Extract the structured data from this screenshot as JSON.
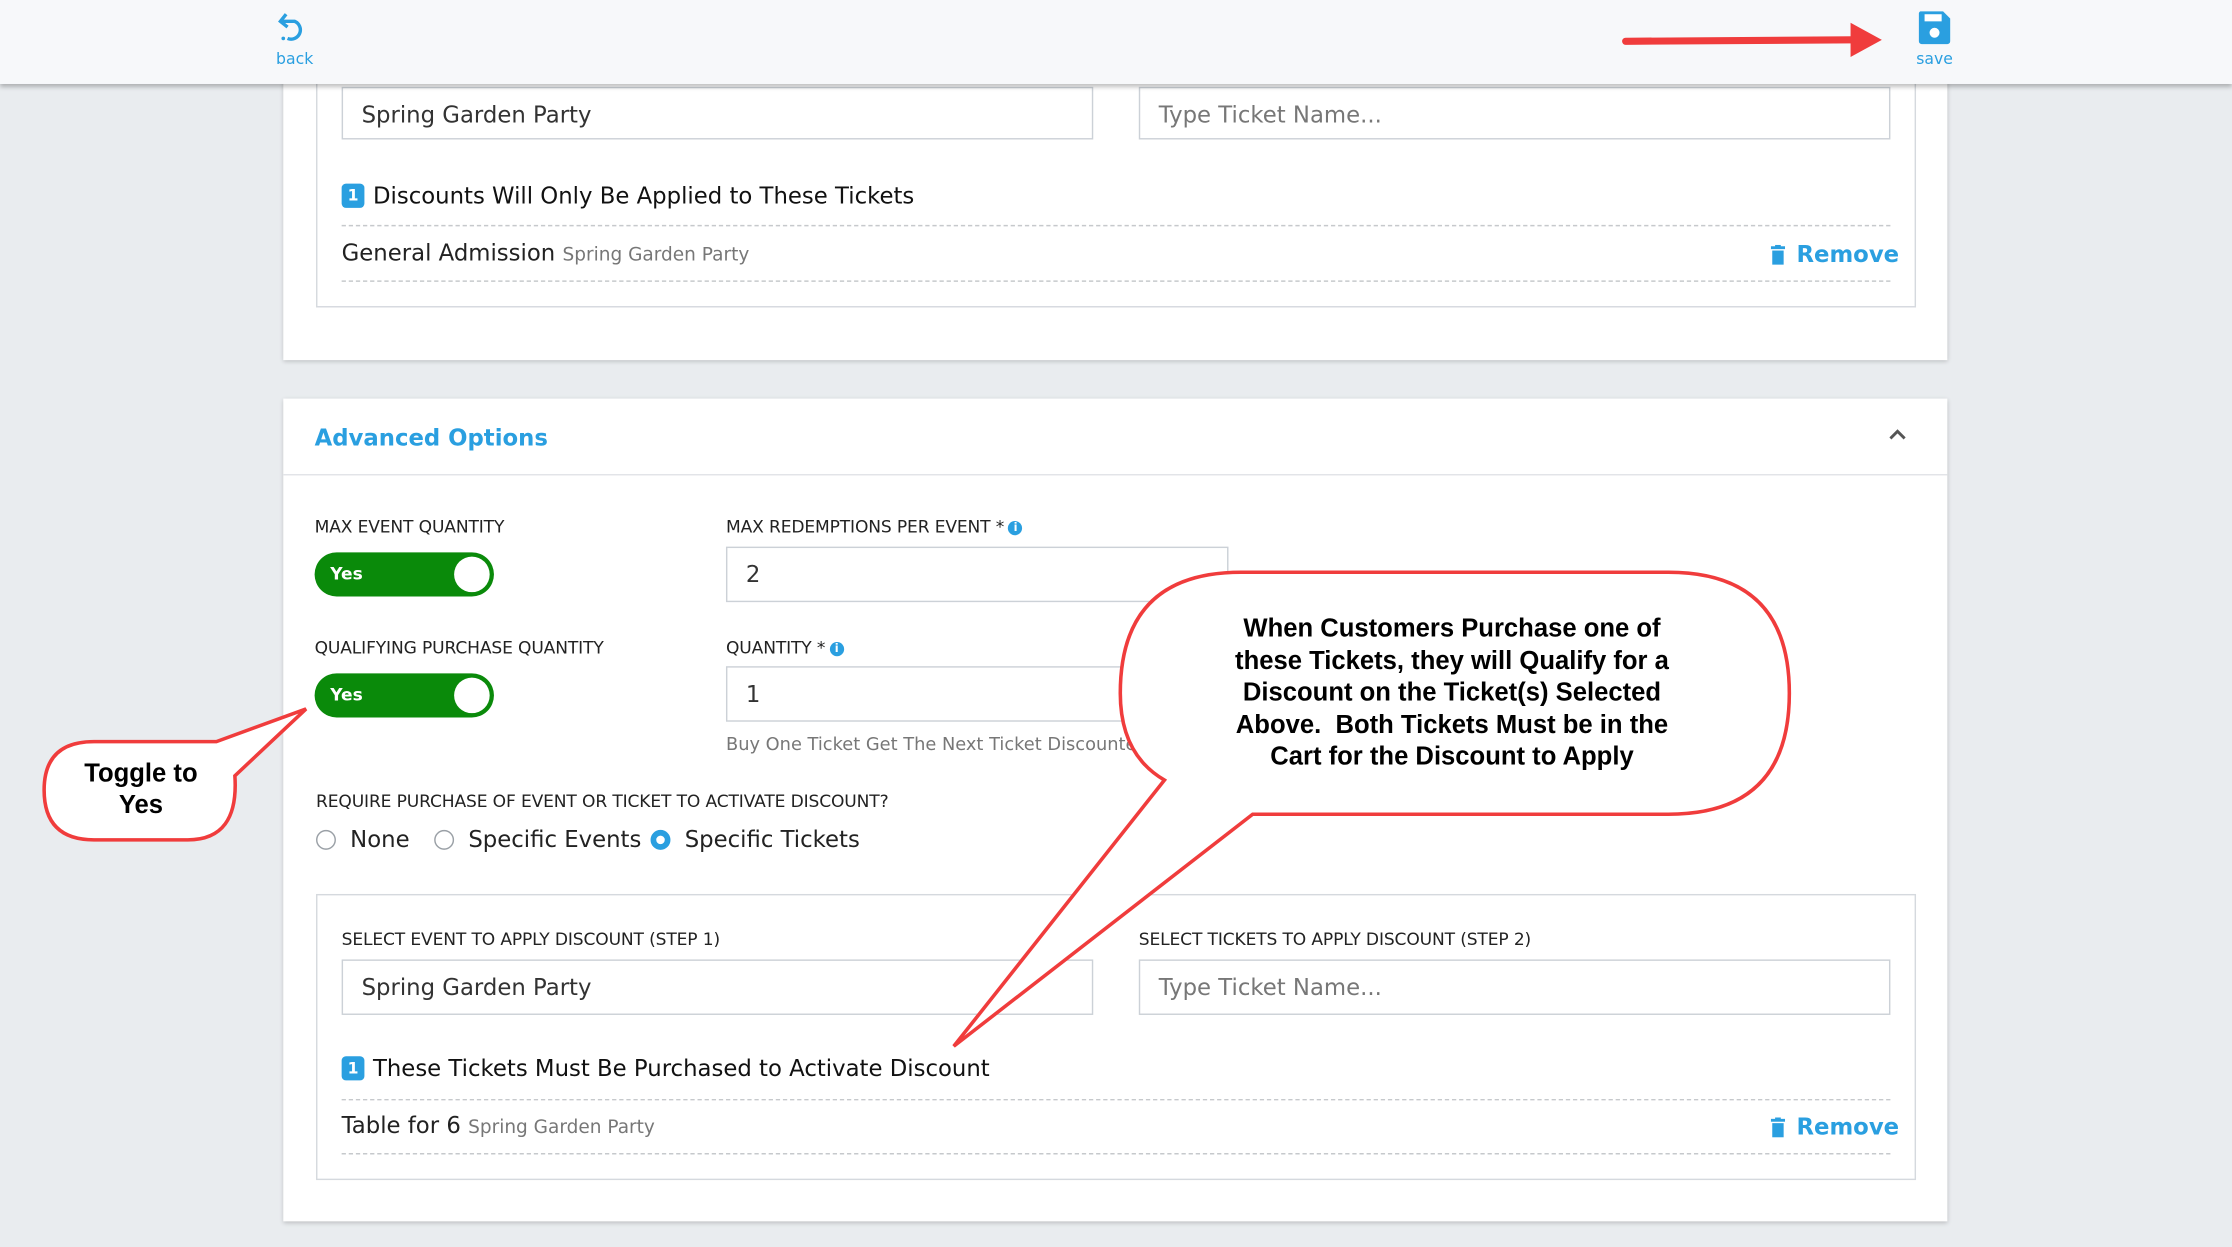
{
  "header": {
    "back_label": "back",
    "save_label": "save"
  },
  "ticket_section": {
    "event_value": "Spring Garden Party",
    "ticket_placeholder": "Type Ticket Name...",
    "count": "1",
    "heading": "Discounts Will Only Be Applied to These Tickets",
    "items": [
      {
        "name": "General Admission",
        "event": "Spring Garden Party",
        "remove_label": "Remove"
      }
    ]
  },
  "advanced": {
    "title": "Advanced Options",
    "max_event_quantity": {
      "label": "MAX EVENT QUANTITY",
      "toggle": "Yes"
    },
    "max_redemptions": {
      "label": "MAX REDEMPTIONS PER EVENT *",
      "value": "2"
    },
    "qualifying_quantity": {
      "label": "QUALIFYING PURCHASE QUANTITY",
      "toggle": "Yes"
    },
    "quantity": {
      "label": "QUANTITY *",
      "value": "1",
      "help": "Buy One Ticket Get The Next Ticket Discounted"
    },
    "require": {
      "label": "REQUIRE PURCHASE OF EVENT OR TICKET TO ACTIVATE DISCOUNT?",
      "options": [
        "None",
        "Specific Events",
        "Specific Tickets"
      ],
      "selected": "Specific Tickets"
    },
    "step1": {
      "label": "SELECT EVENT TO APPLY DISCOUNT (STEP 1)",
      "value": "Spring Garden Party"
    },
    "step2": {
      "label": "SELECT TICKETS TO APPLY DISCOUNT (STEP 2)",
      "placeholder": "Type Ticket Name..."
    },
    "count": "1",
    "heading": "These Tickets Must Be Purchased to Activate Discount",
    "items": [
      {
        "name": "Table for 6",
        "event": "Spring Garden Party",
        "remove_label": "Remove"
      }
    ]
  },
  "annotations": {
    "toggle_note": [
      "Toggle to",
      "Yes"
    ],
    "discount_note": [
      "When Customers Purchase one of",
      "these Tickets, they will Qualify for a",
      "Discount on the Ticket(s) Selected",
      "Above.  Both Tickets Must be in the",
      "Cart for the Discount to Apply"
    ],
    "color": "#f03c3c"
  },
  "colors": {
    "accent": "#2a9fe0",
    "toggle_on": "#0a8a0a",
    "background": "#e9ecef"
  }
}
